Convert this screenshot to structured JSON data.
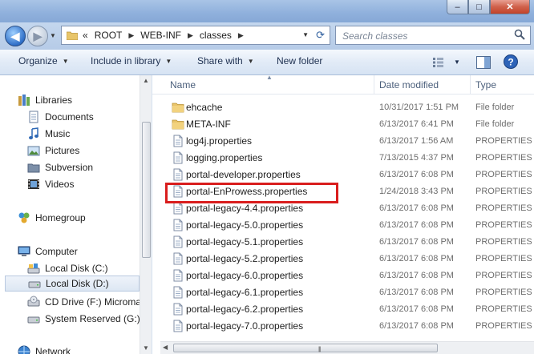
{
  "window": {
    "min_label": "–",
    "max_label": "□",
    "close_label": "✕"
  },
  "address": {
    "chevron": "«",
    "parts": [
      "ROOT",
      "WEB-INF",
      "classes"
    ]
  },
  "search": {
    "placeholder": "Search classes"
  },
  "toolbar": {
    "organize": "Organize",
    "include_in_library": "Include in library",
    "share_with": "Share with",
    "new_folder": "New folder"
  },
  "nav": {
    "items": [
      {
        "label": "Libraries",
        "icon": "libraries-icon"
      },
      {
        "label": "Documents",
        "icon": "documents-icon"
      },
      {
        "label": "Music",
        "icon": "music-icon"
      },
      {
        "label": "Pictures",
        "icon": "pictures-icon"
      },
      {
        "label": "Subversion",
        "icon": "subversion-icon"
      },
      {
        "label": "Videos",
        "icon": "videos-icon"
      },
      {
        "label": "Homegroup",
        "icon": "homegroup-icon"
      },
      {
        "label": "Computer",
        "icon": "computer-icon"
      },
      {
        "label": "Local Disk (C:)",
        "icon": "disk-c-icon"
      },
      {
        "label": "Local Disk (D:)",
        "icon": "disk-d-icon",
        "selected": true
      },
      {
        "label": "CD Drive (F:) Micromax",
        "icon": "cd-drive-icon"
      },
      {
        "label": "System Reserved (G:)",
        "icon": "disk-g-icon"
      },
      {
        "label": "Network",
        "icon": "network-icon"
      }
    ]
  },
  "columns": {
    "name": "Name",
    "date": "Date modified",
    "type": "Type"
  },
  "files": [
    {
      "name": "ehcache",
      "date": "10/31/2017 1:51 PM",
      "type": "File folder",
      "kind": "folder"
    },
    {
      "name": "META-INF",
      "date": "6/13/2017 6:41 PM",
      "type": "File folder",
      "kind": "folder"
    },
    {
      "name": "log4j.properties",
      "date": "6/13/2017 1:56 AM",
      "type": "PROPERTIES",
      "kind": "file"
    },
    {
      "name": "logging.properties",
      "date": "7/13/2015 4:37 PM",
      "type": "PROPERTIES",
      "kind": "file"
    },
    {
      "name": "portal-developer.properties",
      "date": "6/13/2017 6:08 PM",
      "type": "PROPERTIES",
      "kind": "file"
    },
    {
      "name": "portal-EnProwess.properties",
      "date": "1/24/2018 3:43 PM",
      "type": "PROPERTIES",
      "kind": "file"
    },
    {
      "name": "portal-legacy-4.4.properties",
      "date": "6/13/2017 6:08 PM",
      "type": "PROPERTIES",
      "kind": "file"
    },
    {
      "name": "portal-legacy-5.0.properties",
      "date": "6/13/2017 6:08 PM",
      "type": "PROPERTIES",
      "kind": "file"
    },
    {
      "name": "portal-legacy-5.1.properties",
      "date": "6/13/2017 6:08 PM",
      "type": "PROPERTIES",
      "kind": "file"
    },
    {
      "name": "portal-legacy-5.2.properties",
      "date": "6/13/2017 6:08 PM",
      "type": "PROPERTIES",
      "kind": "file"
    },
    {
      "name": "portal-legacy-6.0.properties",
      "date": "6/13/2017 6:08 PM",
      "type": "PROPERTIES",
      "kind": "file"
    },
    {
      "name": "portal-legacy-6.1.properties",
      "date": "6/13/2017 6:08 PM",
      "type": "PROPERTIES",
      "kind": "file"
    },
    {
      "name": "portal-legacy-6.2.properties",
      "date": "6/13/2017 6:08 PM",
      "type": "PROPERTIES",
      "kind": "file"
    },
    {
      "name": "portal-legacy-7.0.properties",
      "date": "6/13/2017 6:08 PM",
      "type": "PROPERTIES",
      "kind": "file"
    }
  ],
  "colors": {
    "highlight": "#d91d1d",
    "accent": "#2f6fc8"
  }
}
